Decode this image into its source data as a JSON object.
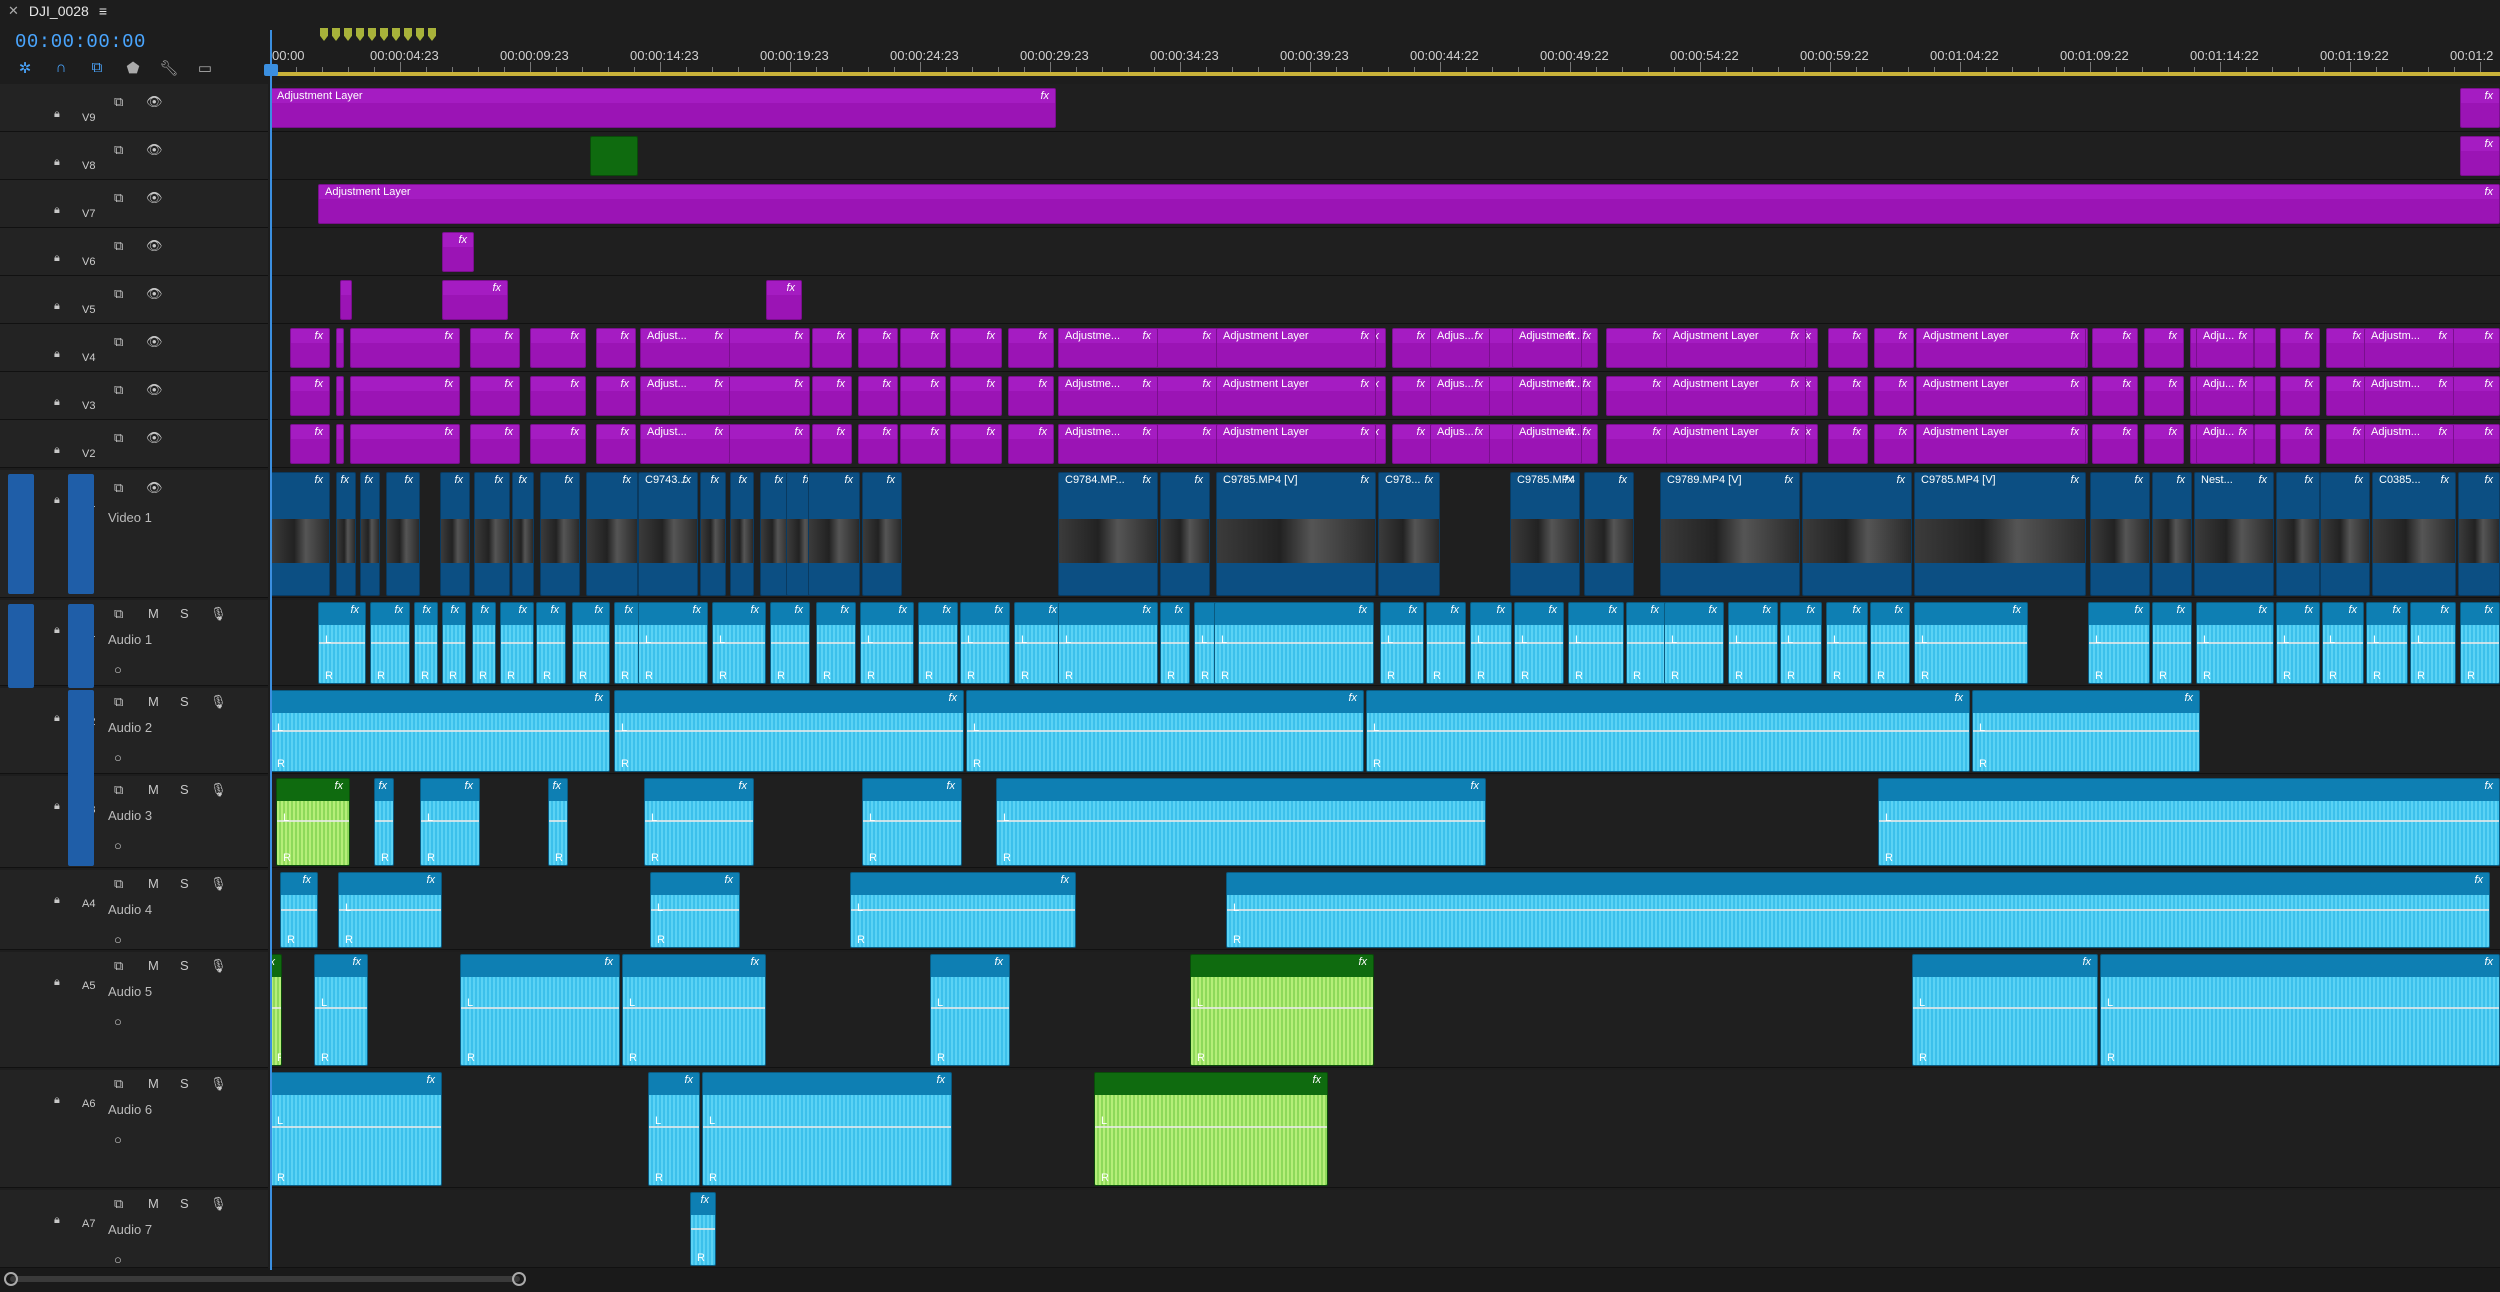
{
  "sequence": {
    "name": "DJI_0028",
    "timecode": "00:00:00:00"
  },
  "colors": {
    "adjustment": "#9b14b5",
    "video": "#0c4f83",
    "audio": "#0e7fb3",
    "audio_wave": "#5fd7f8",
    "green_clip": "#0f6b0f",
    "playhead": "#3b8fe0"
  },
  "tools": [
    "snap-icon",
    "linked-selection-icon",
    "marker-add-icon",
    "marker-icon",
    "wrench-icon",
    "captions-icon"
  ],
  "ruler": [
    "00:00",
    "00:00:04:23",
    "00:00:09:23",
    "00:00:14:23",
    "00:00:19:23",
    "00:00:24:23",
    "00:00:29:23",
    "00:00:34:23",
    "00:00:39:23",
    "00:00:44:22",
    "00:00:49:22",
    "00:00:54:22",
    "00:00:59:22",
    "00:01:04:22",
    "00:01:09:22",
    "00:01:14:22",
    "00:01:19:22",
    "00:01:2"
  ],
  "tracks": {
    "video": [
      {
        "id": "V9"
      },
      {
        "id": "V8"
      },
      {
        "id": "V7"
      },
      {
        "id": "V6"
      },
      {
        "id": "V5"
      },
      {
        "id": "V4"
      },
      {
        "id": "V3"
      },
      {
        "id": "V2"
      },
      {
        "id": "V1",
        "name": "Video 1"
      }
    ],
    "audio": [
      {
        "id": "A1",
        "name": "Audio 1"
      },
      {
        "id": "A2",
        "name": "Audio 2"
      },
      {
        "id": "A3",
        "name": "Audio 3"
      },
      {
        "id": "A4",
        "name": "Audio 4"
      },
      {
        "id": "A5",
        "name": "Audio 5"
      },
      {
        "id": "A6",
        "name": "Audio 6"
      },
      {
        "id": "A7",
        "name": "Audio 7"
      }
    ]
  },
  "clip_labels": {
    "adjustment": "Adjustment Layer",
    "adjust_short": "Adjust...",
    "adjustme": "Adjustme...",
    "adjustment_short": "Adjustment...",
    "adjus": "Adjus...",
    "adju": "Adju...",
    "adjustm": "Adjustm...",
    "fx": "fx",
    "v1_clips": [
      "C9743...",
      "C9784.MP...",
      "C9785.MP4 [V]",
      "C978...",
      "C9785.MP4 ...",
      "C9789.MP4 [V]",
      "C9785.MP4 [V]",
      "Nest...",
      "C0385..."
    ],
    "badge": "-1",
    "R": "R",
    "L": "L",
    "M": "M",
    "S": "S"
  }
}
